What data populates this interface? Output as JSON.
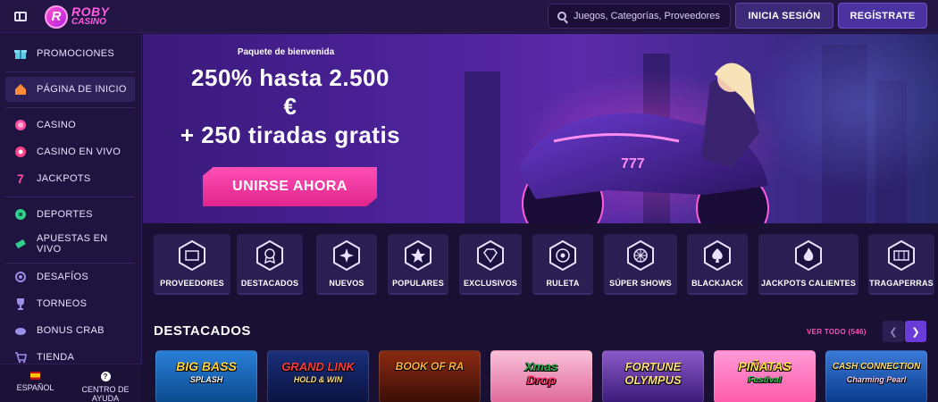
{
  "header": {
    "logo_top": "ROBY",
    "logo_bottom": "CASINO",
    "logo_letter": "R",
    "search_placeholder": "Juegos, Categorías, Proveedores",
    "login_label": "INICIA SESIÓN",
    "register_label": "REGÍSTRATE"
  },
  "sidebar": {
    "items": [
      {
        "label": "PROMOCIONES",
        "icon": "gift-icon"
      },
      {
        "label": "PÁGINA DE INICIO",
        "icon": "home-icon",
        "active": true
      },
      {
        "label": "CASINO",
        "icon": "chip-icon"
      },
      {
        "label": "CASINO EN VIVO",
        "icon": "live-icon"
      },
      {
        "label": "JACKPOTS",
        "icon": "seven-icon"
      },
      {
        "label": "DEPORTES",
        "icon": "ball-icon"
      },
      {
        "label": "APUESTAS EN VIVO",
        "icon": "ticket-icon"
      },
      {
        "label": "DESAFÍOS",
        "icon": "medal-icon"
      },
      {
        "label": "TORNEOS",
        "icon": "trophy-icon"
      },
      {
        "label": "BONUS CRAB",
        "icon": "crab-icon"
      },
      {
        "label": "TIENDA",
        "icon": "cart-icon"
      }
    ],
    "footer": {
      "language_label": "ESPAÑOL",
      "help_label": "CENTRO DE AYUDA"
    }
  },
  "hero": {
    "subtitle": "Paquete de bienvenida",
    "title_line1": "250% hasta 2.500",
    "title_line2": "€",
    "title_line3": "+ 250 tiradas gratis",
    "cta_label": "UNIRSE AHORA",
    "bike_plate": "777"
  },
  "categories": [
    {
      "label": "PROVEEDORES",
      "icon": "folder-icon"
    },
    {
      "label": "DESTACADOS",
      "icon": "badge-icon"
    },
    {
      "label": "NUEVOS",
      "icon": "sparkle-icon"
    },
    {
      "label": "POPULARES",
      "icon": "star-icon"
    },
    {
      "label": "EXCLUSIVOS",
      "icon": "diamond-icon"
    },
    {
      "label": "RULETA",
      "icon": "roulette-icon"
    },
    {
      "label": "SÚPER SHOWS",
      "icon": "wheel-icon"
    },
    {
      "label": "BLACKJACK",
      "icon": "spade-icon"
    },
    {
      "label": "JACKPOTS CALIENTES",
      "icon": "flame-icon"
    },
    {
      "label": "TRAGAPERRAS",
      "icon": "slot-icon"
    }
  ],
  "featured": {
    "title": "DESTACADOS",
    "view_all": "VER TODO (546)",
    "games": [
      {
        "name": "BIG BASS",
        "sub": "SPLASH"
      },
      {
        "name": "GRAND LINK",
        "sub": "HOLD & WIN"
      },
      {
        "name": "BOOK OF RA",
        "sub": ""
      },
      {
        "name": "Xmas",
        "sub": "Drop"
      },
      {
        "name": "FORTUNE",
        "sub": "OLYMPUS"
      },
      {
        "name": "PIÑATAS",
        "sub": "Festival"
      },
      {
        "name": "CASH CONNECTION",
        "sub": "Charming Pearl"
      }
    ]
  },
  "colors": {
    "accent_pink": "#ff4fb5",
    "background": "#1a1033",
    "panel": "#2a1f52"
  }
}
